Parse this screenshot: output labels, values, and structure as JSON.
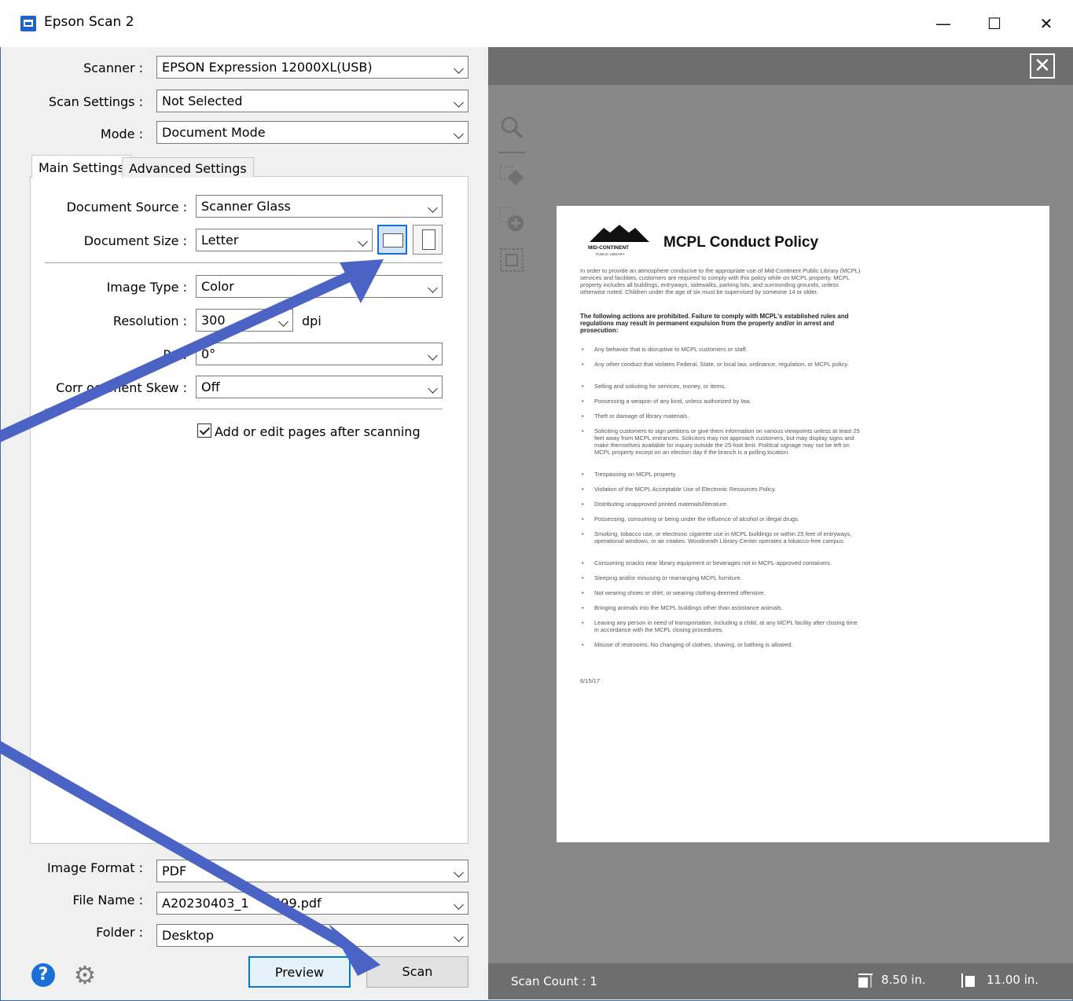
{
  "window": {
    "title": "Epson Scan 2",
    "minimize_glyph": "—",
    "maximize_glyph": "☐",
    "close_glyph": "✕"
  },
  "top_settings": {
    "scanner": {
      "label": "Scanner :",
      "value": "EPSON Expression 12000XL(USB)"
    },
    "scan_settings": {
      "label": "Scan Settings :",
      "value": "Not Selected"
    },
    "mode": {
      "label": "Mode :",
      "value": "Document Mode"
    }
  },
  "tabs": [
    {
      "label": "Main Settings",
      "active": true
    },
    {
      "label": "Advanced Settings",
      "active": false
    }
  ],
  "main_settings": {
    "document_source": {
      "label": "Document Source :",
      "value": "Scanner Glass"
    },
    "document_size": {
      "label": "Document Size :",
      "value": "Letter"
    },
    "image_type": {
      "label": "Image Type :",
      "value": "Color"
    },
    "resolution": {
      "label": "Resolution :",
      "value": "300",
      "unit": "dpi"
    },
    "rotate": {
      "label": "Ro   :",
      "value": "0°"
    },
    "skew": {
      "label": "Corr     ocument Skew :",
      "value": "Off"
    },
    "add_pages": {
      "label": "Add or edit pages after scanning",
      "checked": true
    }
  },
  "bottom_settings": {
    "image_format": {
      "label": "Image Format :",
      "value": "PDF"
    },
    "file_name": {
      "label": "File Name :",
      "value": "A20230403_1      499.pdf"
    },
    "folder": {
      "label": "Folder :",
      "value": "Desktop"
    }
  },
  "buttons": {
    "preview": "Preview",
    "scan": "Scan",
    "help_glyph": "?",
    "settings_glyph": "⚙"
  },
  "preview": {
    "close_glyph": "✕",
    "scan_count": "Scan Count : 1",
    "width": "8.50 in.",
    "height": "11.00 in.",
    "document": {
      "logo_text": "MID-CONTINENT",
      "logo_sub": "PUBLIC LIBRARY",
      "title": "MCPL Conduct Policy",
      "intro": "In order to provide an atmosphere conducive to the appropriate use of Mid-Continent Public Library (MCPL) services and facilities, customers are required to comply with this policy while on MCPL property. MCPL property includes all buildings, entryways, sidewalks, parking lots, and surrounding grounds, unless otherwise noted. Children under the age of six must be supervised by someone 14 or older.",
      "warning": "The following actions are prohibited. Failure to comply with MCPL's established rules and regulations may result in permanent expulsion from the property and/or in arrest and prosecution:",
      "bullets": [
        "Any behavior that is disruptive to MCPL customers or staff.",
        "Any other conduct that violates Federal, State, or local law, ordinance, regulation, or MCPL policy.",
        "Selling and soliciting for services, money, or items.",
        "Possessing a weapon of any kind, unless authorized by law.",
        "Theft or damage of library materials.",
        "Soliciting customers to sign petitions or give them information on various viewpoints unless at least 25 feet away from MCPL entrances. Solicitors may not approach customers, but may display signs and make themselves available for inquiry outside the 25-foot limit. Political signage may not be left on MCPL property except on an election day if the branch is a polling location.",
        "Trespassing on MCPL property.",
        "Violation of the MCPL Acceptable Use of Electronic Resources Policy.",
        "Distributing unapproved printed materials/literature.",
        "Possessing, consuming or being under the influence of alcohol or illegal drugs.",
        "Smoking, tobacco use, or electronic cigarette use in MCPL buildings or within 25 feet of entryways, operational windows, or air intakes. Woodneath Library Center operates a tobacco-free campus.",
        "Consuming snacks near library equipment or beverages not in MCPL-approved containers.",
        "Sleeping and/or misusing or rearranging MCPL furniture.",
        "Not wearing shoes or shirt; or wearing clothing deemed offensive.",
        "Bringing animals into the MCPL buildings other than assistance animals.",
        "Leaving any person in need of transportation, including a child, at any MCPL facility after closing time in accordance with the MCPL closing procedures.",
        "Misuse of restrooms. No changing of clothes, shaving, or bathing is allowed."
      ],
      "date": "6/15/17"
    }
  },
  "colors": {
    "accent": "#1c6fd1",
    "arrow": "#4a63c4",
    "preview_bg": "#888888",
    "preview_bar": "#6e6e6e"
  }
}
